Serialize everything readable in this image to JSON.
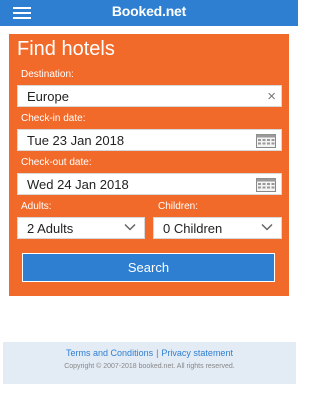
{
  "header": {
    "logo": "Booked.net",
    "menu_icon": "hamburger-menu-icon"
  },
  "form": {
    "title": "Find hotels",
    "destination": {
      "label": "Destination:",
      "value": "Europe",
      "clear_icon": "×"
    },
    "checkin": {
      "label": "Check-in date:",
      "value": "Tue 23 Jan 2018"
    },
    "checkout": {
      "label": "Check-out date:",
      "value": "Wed 24 Jan 2018"
    },
    "adults": {
      "label": "Adults:",
      "value": "2 Adults"
    },
    "children": {
      "label": "Children:",
      "value": "0 Children"
    },
    "search_label": "Search"
  },
  "footer": {
    "terms": "Terms and Conditions",
    "separator": "|",
    "privacy": "Privacy statement",
    "copyright": "Copyright © 2007-2018 booked.net. All rights reserved."
  },
  "colors": {
    "brand_blue": "#2e7fd2",
    "form_orange": "#f26a2a",
    "footer_bg": "#e3ebf5"
  }
}
